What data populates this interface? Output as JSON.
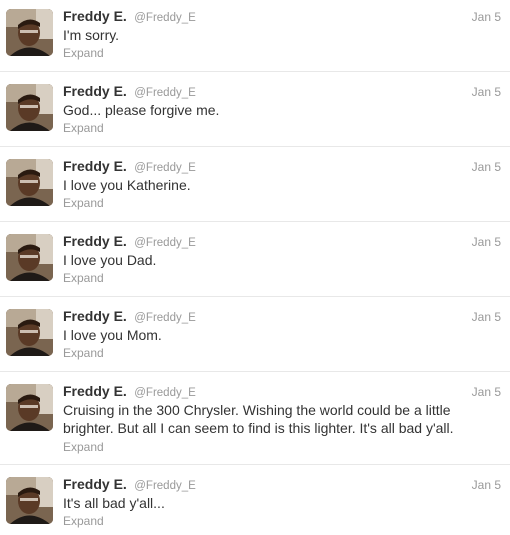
{
  "tweets": [
    {
      "fullname": "Freddy E.",
      "username": "@Freddy_E",
      "time": "Jan 5",
      "text": "I'm sorry.",
      "expand": "Expand"
    },
    {
      "fullname": "Freddy E.",
      "username": "@Freddy_E",
      "time": "Jan 5",
      "text": "God... please forgive me.",
      "expand": "Expand"
    },
    {
      "fullname": "Freddy E.",
      "username": "@Freddy_E",
      "time": "Jan 5",
      "text": "I love you Katherine.",
      "expand": "Expand"
    },
    {
      "fullname": "Freddy E.",
      "username": "@Freddy_E",
      "time": "Jan 5",
      "text": "I love you Dad.",
      "expand": "Expand"
    },
    {
      "fullname": "Freddy E.",
      "username": "@Freddy_E",
      "time": "Jan 5",
      "text": "I love you Mom.",
      "expand": "Expand"
    },
    {
      "fullname": "Freddy E.",
      "username": "@Freddy_E",
      "time": "Jan 5",
      "text": "Cruising in the 300 Chrysler. Wishing the world could be a little brighter. But all I can seem to find is this lighter. It's all bad y'all.",
      "expand": "Expand"
    },
    {
      "fullname": "Freddy E.",
      "username": "@Freddy_E",
      "time": "Jan 5",
      "text": "It's all bad y'all...",
      "expand": "Expand"
    }
  ]
}
